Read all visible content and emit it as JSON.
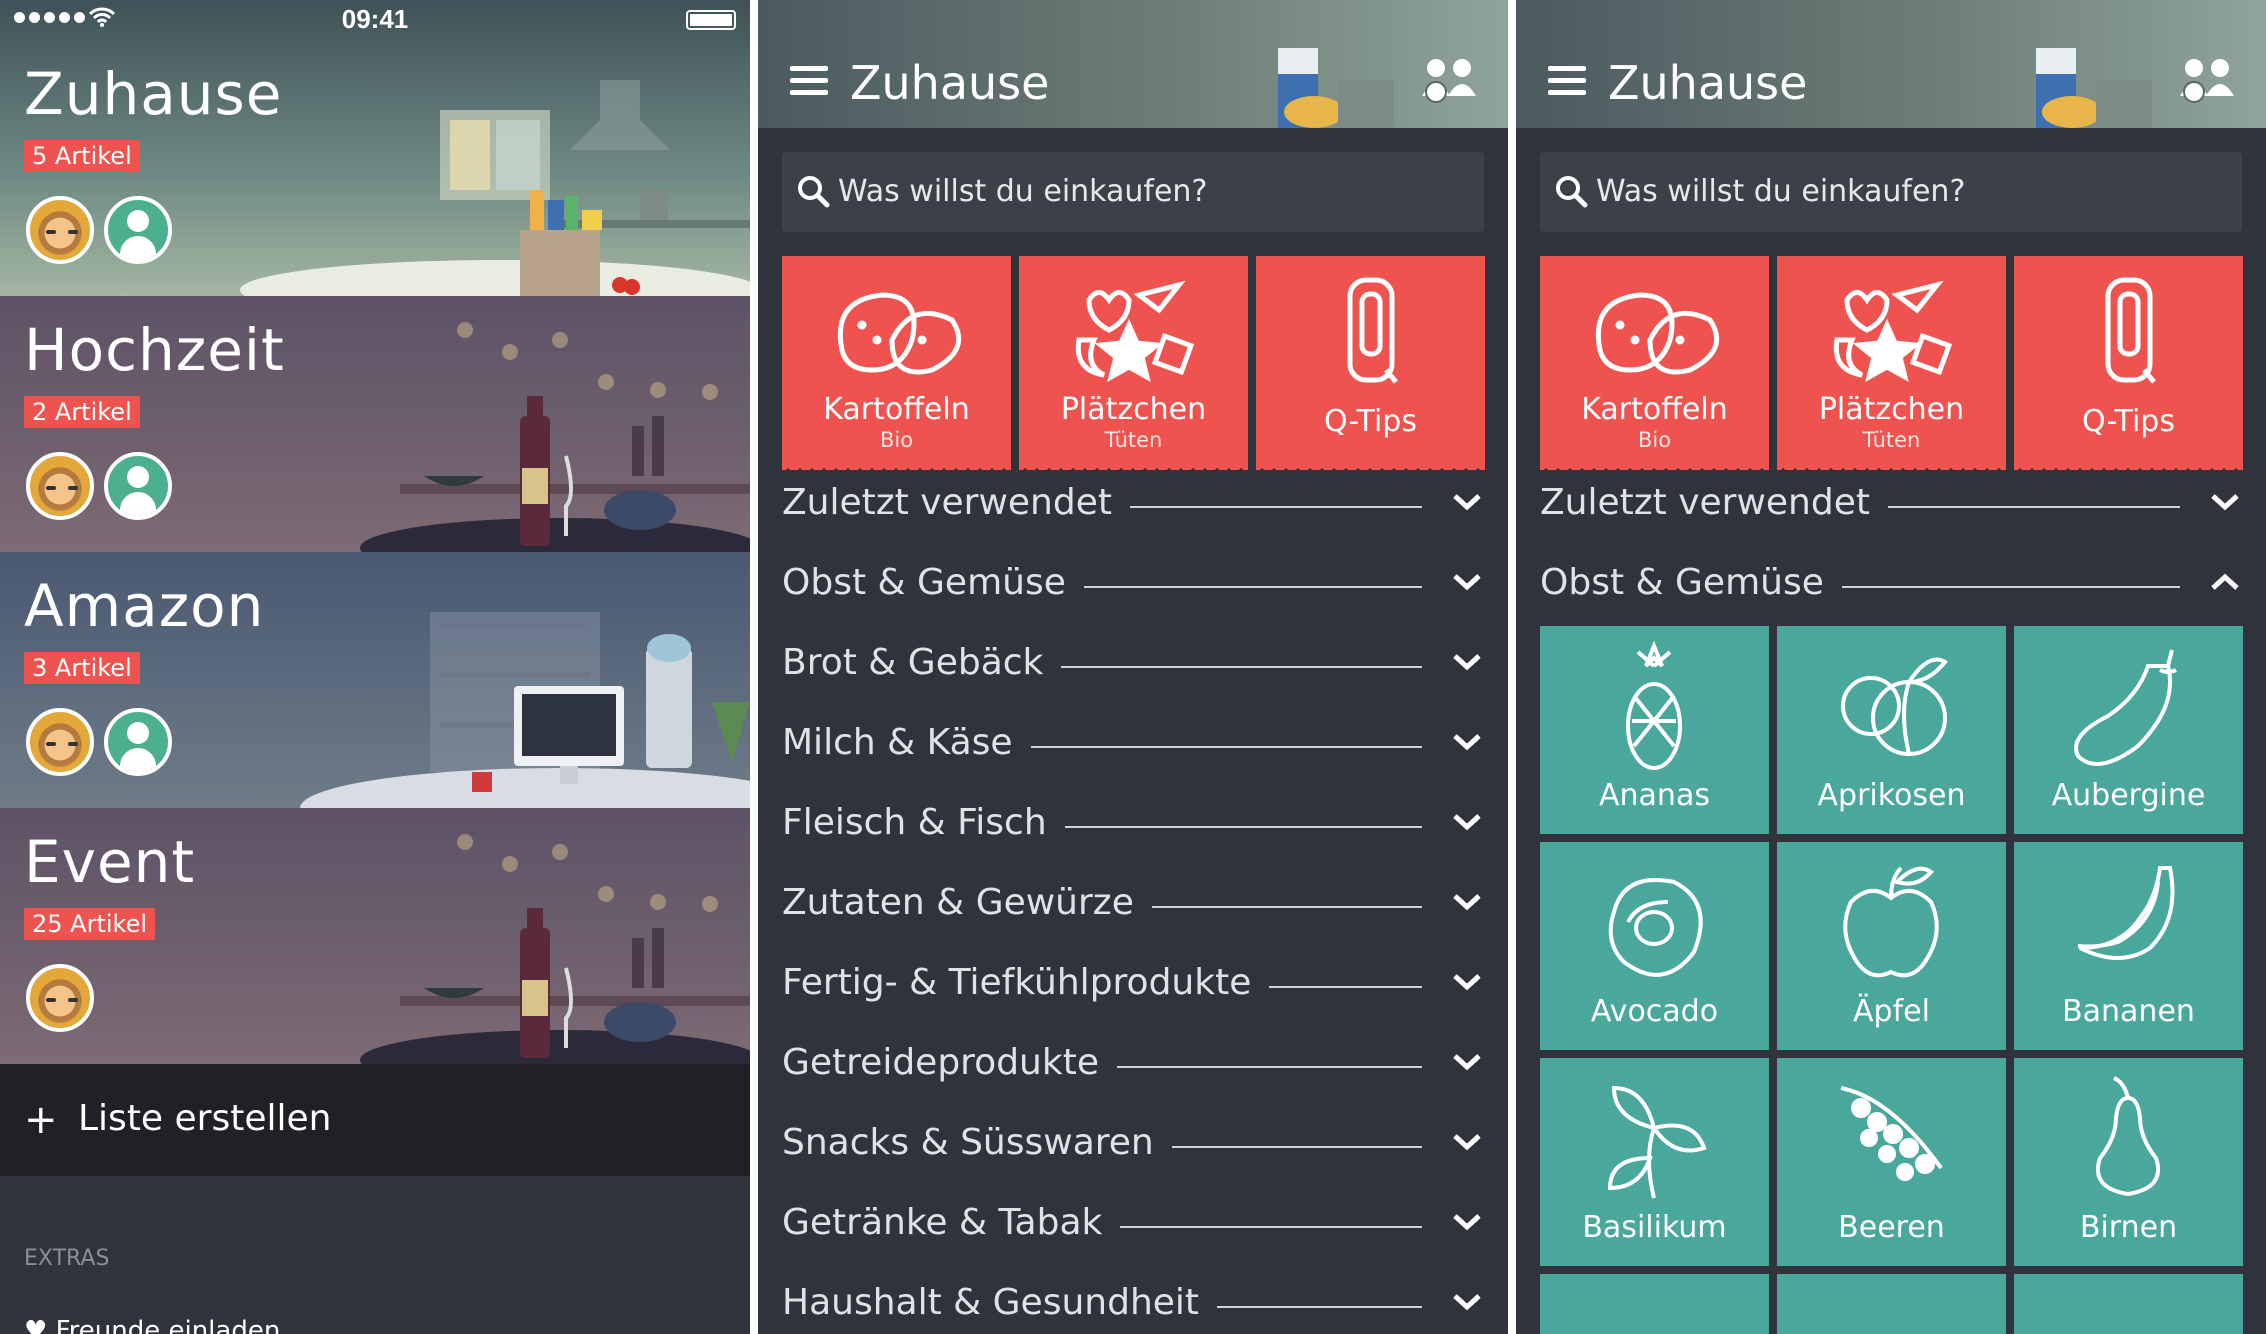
{
  "status": {
    "time": "09:41"
  },
  "lists": [
    {
      "title": "Zuhause",
      "badge": "5 Artikel",
      "members": 2
    },
    {
      "title": "Hochzeit",
      "badge": "2 Artikel",
      "members": 2
    },
    {
      "title": "Amazon",
      "badge": "3 Artikel",
      "members": 2
    },
    {
      "title": "Event",
      "badge": "25 Artikel",
      "members": 1
    }
  ],
  "create_list": {
    "icon": "plus-icon",
    "label": "Liste erstellen"
  },
  "extras": {
    "heading": "EXTRAS",
    "item": "Freunde einladen"
  },
  "header": {
    "title": "Zuhause"
  },
  "search": {
    "placeholder": "Was willst du einkaufen?"
  },
  "recent_tiles": [
    {
      "name": "Kartoffeln",
      "sub": "Bio",
      "icon": "potatoes-icon"
    },
    {
      "name": "Plätzchen",
      "sub": "Tüten",
      "icon": "cookies-icon"
    },
    {
      "name": "Q-Tips",
      "sub": "",
      "icon": "qtips-icon"
    }
  ],
  "categories": [
    "Zuletzt verwendet",
    "Obst & Gemüse",
    "Brot & Gebäck",
    "Milch & Käse",
    "Fleisch & Fisch",
    "Zutaten & Gewürze",
    "Fertig- & Tiefkühlprodukte",
    "Getreideprodukte",
    "Snacks & Süsswaren",
    "Getränke & Tabak",
    "Haushalt & Gesundheit"
  ],
  "produce": [
    {
      "name": "Ananas",
      "icon": "pineapple-icon"
    },
    {
      "name": "Aprikosen",
      "icon": "apricot-icon"
    },
    {
      "name": "Aubergine",
      "icon": "eggplant-icon"
    },
    {
      "name": "Avocado",
      "icon": "avocado-icon"
    },
    {
      "name": "Äpfel",
      "icon": "apple-icon"
    },
    {
      "name": "Bananen",
      "icon": "banana-icon"
    },
    {
      "name": "Basilikum",
      "icon": "basil-icon"
    },
    {
      "name": "Beeren",
      "icon": "berries-icon"
    },
    {
      "name": "Birnen",
      "icon": "pear-icon"
    }
  ],
  "colors": {
    "accent_red": "#ef5350",
    "produce_teal": "#4aa79c",
    "background": "#30333b"
  }
}
